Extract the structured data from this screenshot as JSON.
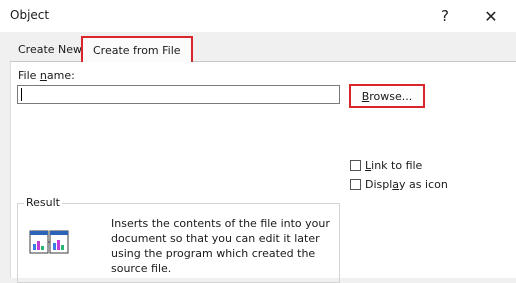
{
  "window": {
    "title": "Object",
    "help_glyph": "?",
    "close_glyph": "✕"
  },
  "tabs": [
    {
      "label": "Create New",
      "selected": false
    },
    {
      "label": "Create from File",
      "selected": true
    }
  ],
  "file_name": {
    "label": "File name:",
    "value": ""
  },
  "browse": {
    "label": "Browse..."
  },
  "options": {
    "link_to_file": {
      "label": "Link to file",
      "checked": false
    },
    "display_as_icon": {
      "label": "Display as icon",
      "checked": false
    }
  },
  "result": {
    "label": "Result",
    "description_lines": [
      "Inserts the contents of the file into your",
      "document so that you can edit it later",
      "using the program which created the",
      "source file."
    ],
    "icon": "embedded-document-icon"
  },
  "colors": {
    "highlight": "#d9262a",
    "panel": "#ffffff",
    "dialog": "#f0f0f0"
  }
}
